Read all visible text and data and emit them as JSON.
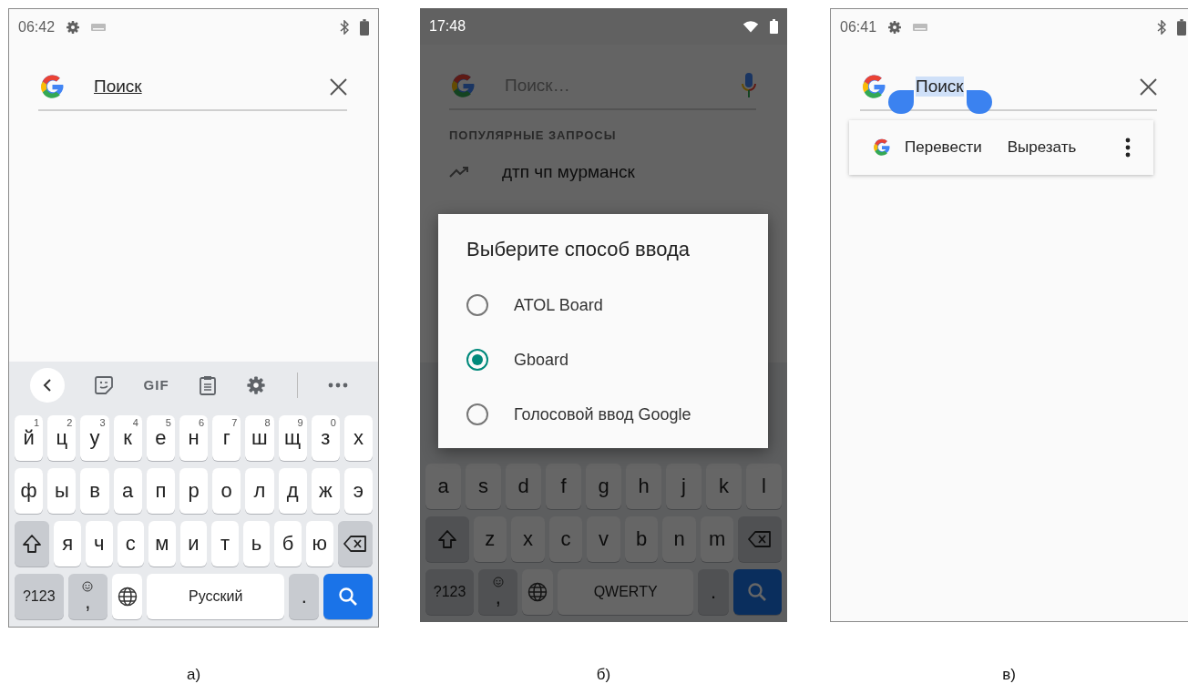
{
  "screens": [
    {
      "kind": "keyboard",
      "caption": "а)",
      "status_bar": {
        "time": "06:42"
      },
      "search": {
        "value": "Поиск",
        "composing": true,
        "text_selected": false
      },
      "keyboard": {
        "gif": "GIF",
        "rows": [
          [
            {
              "kind": "char",
              "label": "й",
              "hint": "1"
            },
            {
              "kind": "char",
              "label": "ц",
              "hint": "2"
            },
            {
              "kind": "char",
              "label": "у",
              "hint": "3"
            },
            {
              "kind": "char",
              "label": "к",
              "hint": "4"
            },
            {
              "kind": "char",
              "label": "е",
              "hint": "5"
            },
            {
              "kind": "char",
              "label": "н",
              "hint": "6"
            },
            {
              "kind": "char",
              "label": "г",
              "hint": "7"
            },
            {
              "kind": "char",
              "label": "ш",
              "hint": "8"
            },
            {
              "kind": "char",
              "label": "щ",
              "hint": "9"
            },
            {
              "kind": "char",
              "label": "з",
              "hint": "0"
            },
            {
              "kind": "char",
              "label": "х"
            }
          ],
          [
            {
              "kind": "char",
              "label": "ф"
            },
            {
              "kind": "char",
              "label": "ы"
            },
            {
              "kind": "char",
              "label": "в"
            },
            {
              "kind": "char",
              "label": "а"
            },
            {
              "kind": "char",
              "label": "п"
            },
            {
              "kind": "char",
              "label": "р"
            },
            {
              "kind": "char",
              "label": "о"
            },
            {
              "kind": "char",
              "label": "л"
            },
            {
              "kind": "char",
              "label": "д"
            },
            {
              "kind": "char",
              "label": "ж"
            },
            {
              "kind": "char",
              "label": "э"
            }
          ],
          [
            {
              "kind": "shift"
            },
            {
              "kind": "char",
              "label": "я"
            },
            {
              "kind": "char",
              "label": "ч"
            },
            {
              "kind": "char",
              "label": "с"
            },
            {
              "kind": "char",
              "label": "м"
            },
            {
              "kind": "char",
              "label": "и"
            },
            {
              "kind": "char",
              "label": "т"
            },
            {
              "kind": "char",
              "label": "ь"
            },
            {
              "kind": "char",
              "label": "б"
            },
            {
              "kind": "char",
              "label": "ю"
            },
            {
              "kind": "backspace"
            }
          ]
        ],
        "bottom_row": [
          {
            "kind": "symbols",
            "label": "?123"
          },
          {
            "kind": "comma",
            "label": ","
          },
          {
            "kind": "globe"
          },
          {
            "kind": "space",
            "label": "Русский"
          },
          {
            "kind": "period",
            "label": "."
          },
          {
            "kind": "search"
          }
        ]
      }
    },
    {
      "kind": "ime_picker",
      "caption": "б)",
      "status_bar": {
        "time": "17:48"
      },
      "search": {
        "placeholder": "Поиск…"
      },
      "section_title": "ПОПУЛЯРНЫЕ ЗАПРОСЫ",
      "suggestions": [
        "дтп чп мурманск"
      ],
      "keyboard": {
        "rows": [
          [
            {
              "kind": "char",
              "label": "a"
            },
            {
              "kind": "char",
              "label": "s"
            },
            {
              "kind": "char",
              "label": "d"
            },
            {
              "kind": "char",
              "label": "f"
            },
            {
              "kind": "char",
              "label": "g"
            },
            {
              "kind": "char",
              "label": "h"
            },
            {
              "kind": "char",
              "label": "j"
            },
            {
              "kind": "char",
              "label": "k"
            },
            {
              "kind": "char",
              "label": "l"
            }
          ],
          [
            {
              "kind": "shift"
            },
            {
              "kind": "char",
              "label": "z"
            },
            {
              "kind": "char",
              "label": "x"
            },
            {
              "kind": "char",
              "label": "c"
            },
            {
              "kind": "char",
              "label": "v"
            },
            {
              "kind": "char",
              "label": "b"
            },
            {
              "kind": "char",
              "label": "n"
            },
            {
              "kind": "char",
              "label": "m"
            },
            {
              "kind": "backspace"
            }
          ]
        ],
        "bottom_row": [
          {
            "kind": "symbols",
            "label": "?123"
          },
          {
            "kind": "comma",
            "label": ","
          },
          {
            "kind": "globe"
          },
          {
            "kind": "space",
            "label": "QWERTY"
          },
          {
            "kind": "period",
            "label": "."
          },
          {
            "kind": "search"
          }
        ]
      },
      "dialog": {
        "title": "Выберите способ ввода",
        "options": [
          {
            "label": "ATOL Board",
            "selected": false
          },
          {
            "label": "Gboard",
            "selected": true
          },
          {
            "label": "Голосовой ввод Google",
            "selected": false
          }
        ]
      }
    },
    {
      "kind": "text_selection",
      "caption": "в)",
      "status_bar": {
        "time": "06:41"
      },
      "search": {
        "value": "Поиск",
        "composing": false,
        "text_selected": true
      },
      "context_menu": {
        "items": [
          "Перевести",
          "Вырезать"
        ]
      }
    }
  ]
}
